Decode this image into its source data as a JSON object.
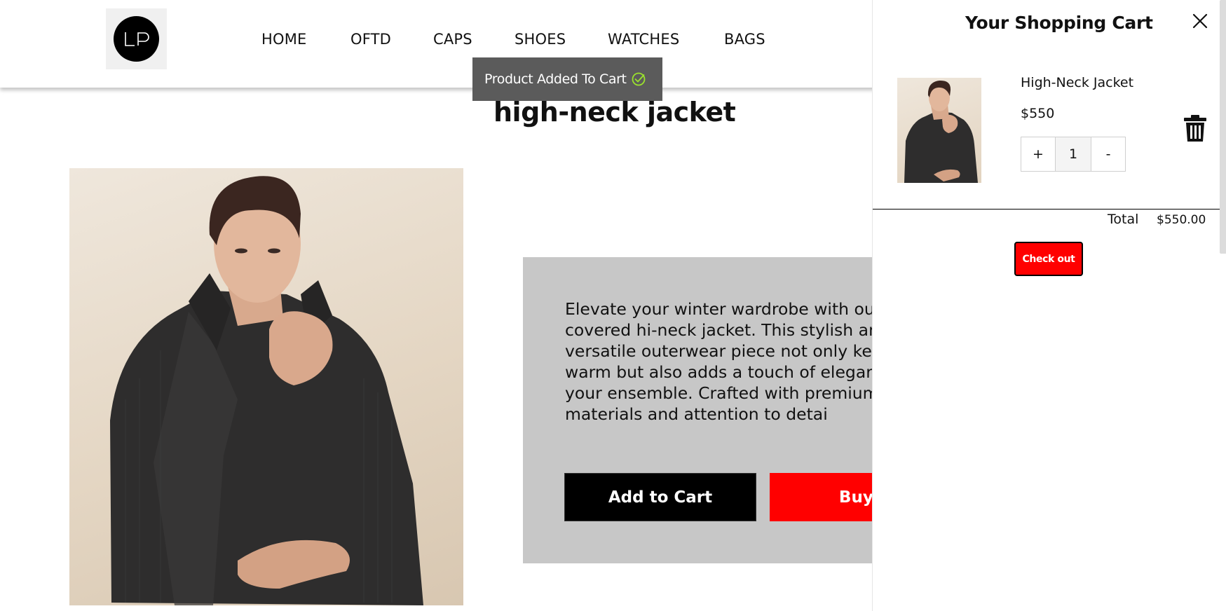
{
  "brand": {
    "logo_text": "LP"
  },
  "nav": {
    "items": [
      {
        "label": "HOME"
      },
      {
        "label": "OFTD"
      },
      {
        "label": "CAPS"
      },
      {
        "label": "SHOES"
      },
      {
        "label": "WATCHES"
      },
      {
        "label": "BAGS"
      }
    ]
  },
  "toast": {
    "message": "Product Added To Cart",
    "icon": "check-circle-icon"
  },
  "product": {
    "title": "high-neck jacket",
    "description_lines": [
      "Elevate your winter wardrobe with ou",
      "covered hi-neck jacket. This stylish an",
      "versatile outerwear piece not only kee",
      "warm but also adds a touch of elegar",
      "your ensemble. Crafted with premium",
      "materials and attention to detai"
    ],
    "add_to_cart_label": "Add to Cart",
    "buy_now_label": "Buy N"
  },
  "cart": {
    "title": "Your Shopping Cart",
    "items": [
      {
        "name": "High-Neck Jacket",
        "price": "$550",
        "quantity": "1"
      }
    ],
    "plus_label": "+",
    "minus_label": "-",
    "total_label": "Total",
    "total_value": "$550.00",
    "checkout_label": "Check out"
  },
  "colors": {
    "accent": "#ff0000",
    "toast_bg": "#5b5b5b",
    "panel_bg": "#c7c7c7",
    "check_green": "#9be22d"
  }
}
